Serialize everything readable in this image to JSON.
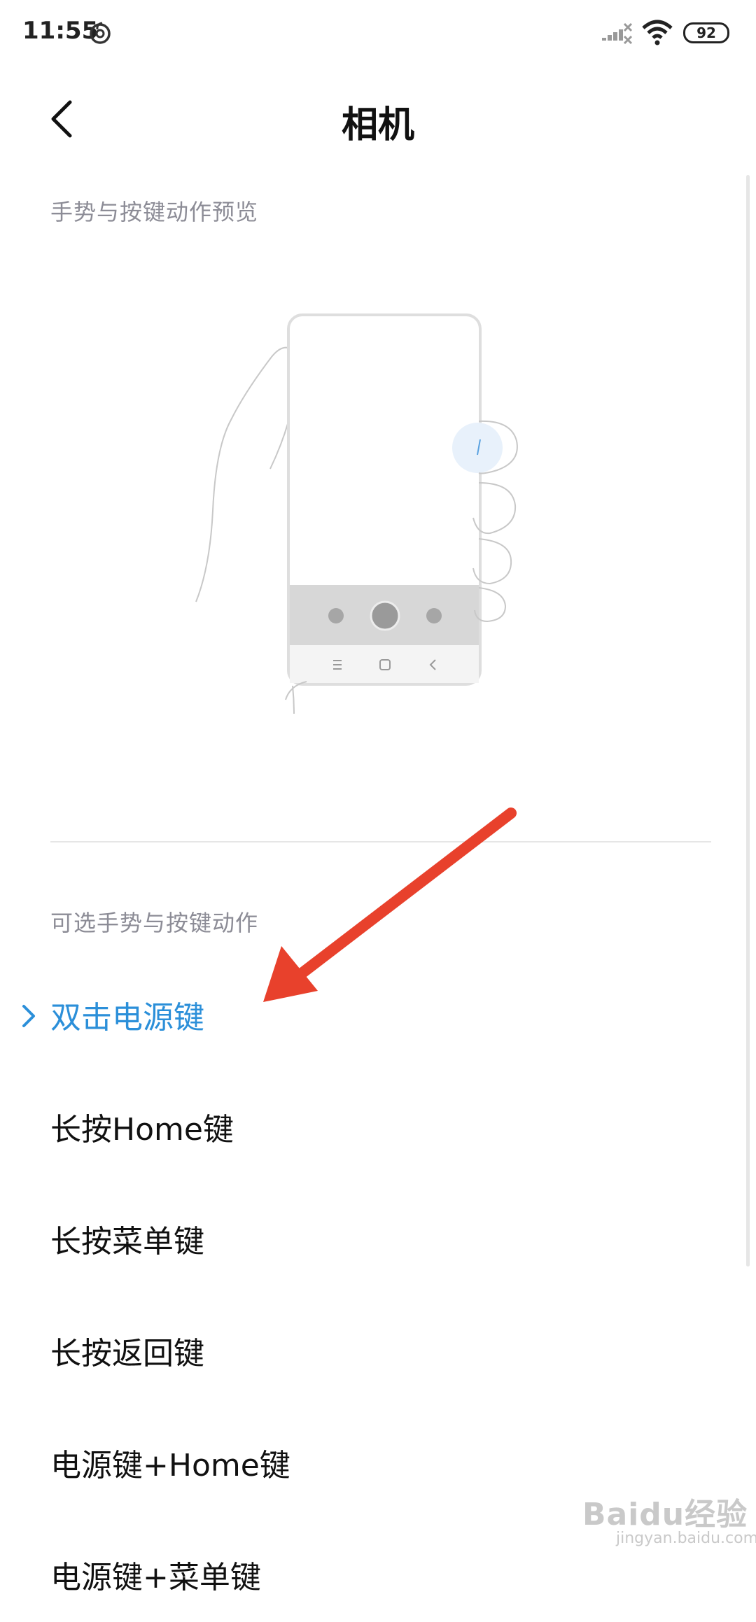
{
  "status_bar": {
    "time": "11:55",
    "battery": "92",
    "icons": [
      "netease-music-icon",
      "signal-off-icon",
      "wifi-icon",
      "battery-icon"
    ]
  },
  "header": {
    "title": "相机",
    "back_icon": "back-chevron-icon"
  },
  "preview_section": {
    "label": "手势与按键动作预览"
  },
  "options_section": {
    "label": "可选手势与按键动作",
    "items": [
      {
        "label": "双击电源键",
        "selected": true
      },
      {
        "label": "长按Home键",
        "selected": false
      },
      {
        "label": "长按菜单键",
        "selected": false
      },
      {
        "label": "长按返回键",
        "selected": false
      },
      {
        "label": "电源键+Home键",
        "selected": false
      },
      {
        "label": "电源键+菜单键",
        "selected": false
      }
    ]
  },
  "colors": {
    "accent": "#2b8fd9",
    "section_label": "#8c8c96",
    "annotation_arrow": "#e8412c"
  },
  "watermark": {
    "text": "Baidu经验",
    "sub": "jingyan.baidu.com"
  }
}
